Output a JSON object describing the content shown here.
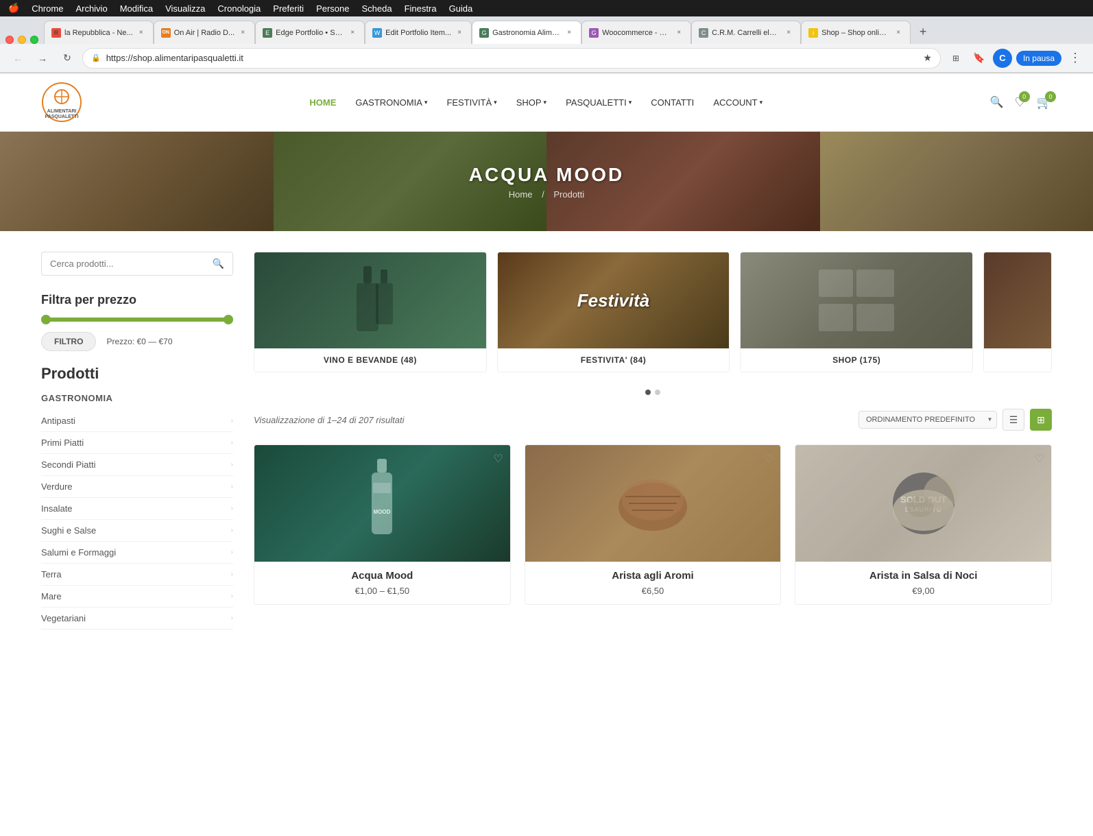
{
  "os": {
    "menubar": {
      "apple": "🍎",
      "items": [
        "Chrome",
        "Archivio",
        "Modifica",
        "Visualizza",
        "Cronologia",
        "Preferiti",
        "Persone",
        "Scheda",
        "Finestra",
        "Guida"
      ]
    }
  },
  "browser": {
    "tabs": [
      {
        "id": "tab1",
        "label": "la Repubblica - Ne...",
        "favicon_color": "red",
        "favicon_text": "R",
        "active": false
      },
      {
        "id": "tab2",
        "label": "On Air | Radio D...",
        "favicon_color": "orange",
        "favicon_text": "ON",
        "active": false
      },
      {
        "id": "tab3",
        "label": "Edge Portfolio • SG...",
        "favicon_color": "green",
        "favicon_text": "E",
        "active": false
      },
      {
        "id": "tab4",
        "label": "Edit Portfolio Item...",
        "favicon_color": "blue",
        "favicon_text": "W",
        "active": false
      },
      {
        "id": "tab5",
        "label": "Gastronomia Alime...",
        "favicon_color": "green",
        "favicon_text": "G",
        "active": true
      },
      {
        "id": "tab6",
        "label": "Woocommerce - Ce...",
        "favicon_color": "purple",
        "favicon_text": "G",
        "active": false
      },
      {
        "id": "tab7",
        "label": "C.R.M. Carrelli elev...",
        "favicon_color": "gray",
        "favicon_text": "C",
        "active": false
      },
      {
        "id": "tab8",
        "label": "Shop – Shop online...",
        "favicon_color": "yellow",
        "favicon_text": "i",
        "active": false
      }
    ],
    "address": "https://shop.alimentaripasqualetti.it",
    "pause_label": "In pausa",
    "profile_initial": "C"
  },
  "site": {
    "logo_text": "ALIMENTARI\nPASQUALETTI",
    "nav": [
      {
        "label": "HOME",
        "active": true
      },
      {
        "label": "GASTRONOMIA",
        "has_dropdown": true
      },
      {
        "label": "FESTIVITÀ",
        "has_dropdown": true
      },
      {
        "label": "SHOP",
        "has_dropdown": true
      },
      {
        "label": "PASQUALETTI",
        "has_dropdown": true
      },
      {
        "label": "CONTATTI"
      },
      {
        "label": "ACCOUNT",
        "has_dropdown": true
      }
    ],
    "cart_count": "0",
    "wishlist_count": "0",
    "hero": {
      "title": "ACQUA MOOD",
      "breadcrumb_home": "Home",
      "breadcrumb_separator": "/",
      "breadcrumb_current": "Prodotti"
    },
    "sidebar": {
      "search_placeholder": "Cerca prodotti...",
      "price_filter_title": "Filtra per prezzo",
      "filter_btn_label": "FILTRO",
      "price_range": "Prezzo: €0 — €70",
      "products_title": "Prodotti",
      "category_title": "GASTRONOMIA",
      "categories": [
        "Antipasti",
        "Primi Piatti",
        "Secondi Piatti",
        "Verdure",
        "Insalate",
        "Sughi e Salse",
        "Salumi e Formaggi",
        "Terra",
        "Mare",
        "Vegetariani"
      ]
    },
    "products_area": {
      "categories": [
        {
          "label": "VINO E BEVANDE (48)",
          "style": "green-bg",
          "overlay_text": ""
        },
        {
          "label": "FESTIVITA' (84)",
          "style": "festive-bg",
          "overlay_text": "Festività"
        },
        {
          "label": "SHOP (175)",
          "style": "shop-bg",
          "overlay_text": ""
        },
        {
          "label": "",
          "style": "extra-bg",
          "overlay_text": ""
        }
      ],
      "results_text": "Visualizzazione di 1–24 di 207 risultati",
      "sort_default": "ORDINAMENTO PREDEFINITO",
      "products": [
        {
          "name": "Acqua Mood",
          "price": "€1,00 – €1,50",
          "style": "acqua-bg",
          "sold_out": false
        },
        {
          "name": "Arista agli Aromi",
          "price": "€6,50",
          "style": "arista-bg",
          "sold_out": false
        },
        {
          "name": "Arista in Salsa di Noci",
          "price": "€9,00",
          "style": "salsa-bg",
          "sold_out": true,
          "sold_out_label": "SOLD OUT",
          "sold_out_sub": "ESAURITO"
        }
      ]
    }
  }
}
